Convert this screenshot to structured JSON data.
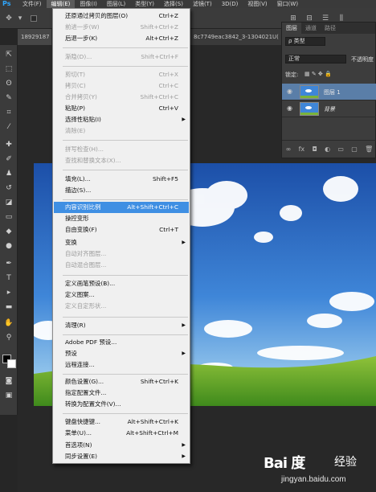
{
  "menubar": {
    "logo": "Ps",
    "items": [
      "文件(F)",
      "编辑(E)",
      "图像(I)",
      "图层(L)",
      "类型(Y)",
      "选择(S)",
      "滤镜(T)",
      "3D(D)",
      "视图(V)",
      "窗口(W)"
    ]
  },
  "optionsbar": {
    "tab_prefix": "18929187",
    "tab_suffix": "8c7749eac3842_3-1304021U("
  },
  "edit_menu": {
    "items": [
      {
        "label": "还原通过拷贝的图层(O)",
        "shortcut": "Ctrl+Z"
      },
      {
        "label": "前进一步(W)",
        "shortcut": "Shift+Ctrl+Z"
      },
      {
        "label": "后退一步(K)",
        "shortcut": "Alt+Ctrl+Z"
      },
      {
        "label": "渐隐(D)...",
        "shortcut": "Shift+Ctrl+F"
      },
      {
        "label": "剪切(T)",
        "shortcut": "Ctrl+X"
      },
      {
        "label": "拷贝(C)",
        "shortcut": "Ctrl+C"
      },
      {
        "label": "合并拷贝(Y)",
        "shortcut": "Shift+Ctrl+C"
      },
      {
        "label": "粘贴(P)",
        "shortcut": "Ctrl+V"
      },
      {
        "label": "选择性粘贴(I)",
        "shortcut": ""
      },
      {
        "label": "清除(E)",
        "shortcut": ""
      },
      {
        "label": "拼写检查(H)...",
        "shortcut": ""
      },
      {
        "label": "查找和替换文本(X)...",
        "shortcut": ""
      },
      {
        "label": "填充(L)...",
        "shortcut": "Shift+F5"
      },
      {
        "label": "描边(S)...",
        "shortcut": ""
      },
      {
        "label": "内容识别比例",
        "shortcut": "Alt+Shift+Ctrl+C"
      },
      {
        "label": "操控变形",
        "shortcut": ""
      },
      {
        "label": "自由变换(F)",
        "shortcut": "Ctrl+T"
      },
      {
        "label": "变换",
        "shortcut": ""
      },
      {
        "label": "自动对齐图层...",
        "shortcut": ""
      },
      {
        "label": "自动混合图层...",
        "shortcut": ""
      },
      {
        "label": "定义画笔预设(B)...",
        "shortcut": ""
      },
      {
        "label": "定义图案...",
        "shortcut": ""
      },
      {
        "label": "定义自定形状...",
        "shortcut": ""
      },
      {
        "label": "清理(R)",
        "shortcut": ""
      },
      {
        "label": "Adobe PDF 预设...",
        "shortcut": ""
      },
      {
        "label": "预设",
        "shortcut": ""
      },
      {
        "label": "远程连接...",
        "shortcut": ""
      },
      {
        "label": "颜色设置(G)...",
        "shortcut": "Shift+Ctrl+K"
      },
      {
        "label": "指定配置文件...",
        "shortcut": ""
      },
      {
        "label": "转换为配置文件(V)...",
        "shortcut": ""
      },
      {
        "label": "键盘快捷键...",
        "shortcut": "Alt+Shift+Ctrl+K"
      },
      {
        "label": "菜单(U)...",
        "shortcut": "Alt+Shift+Ctrl+M"
      },
      {
        "label": "首选项(N)",
        "shortcut": ""
      },
      {
        "label": "同步设置(E)",
        "shortcut": ""
      }
    ]
  },
  "layers_panel": {
    "tabs": [
      "图层",
      "通道",
      "路径"
    ],
    "filter_label": "ρ 类型",
    "blend_mode": "正常",
    "opacity_label": "不透明度",
    "lock_label": "锁定:",
    "layers": [
      {
        "name": "图层 1",
        "selected": true
      },
      {
        "name": "背景",
        "selected": false
      }
    ]
  },
  "watermark": {
    "logo": "Bai 度",
    "suffix": "经验",
    "url": "jingyan.baidu.com"
  },
  "colors": {
    "accent": "#3f8fe3",
    "layer_selected": "#5a7ea8",
    "ps_blue": "#2fa7ff"
  }
}
